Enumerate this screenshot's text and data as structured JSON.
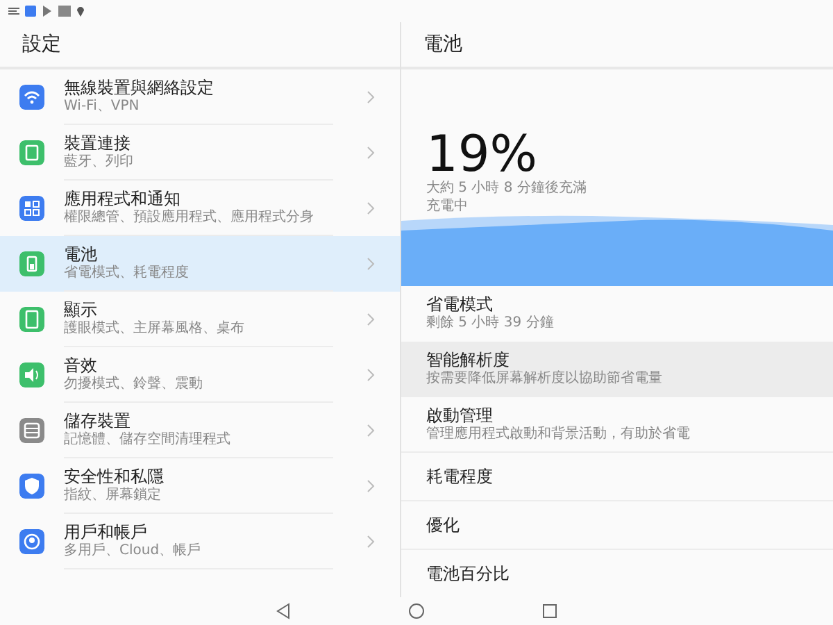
{
  "sidebar": {
    "title": "設定",
    "items": [
      {
        "title": "無線裝置與網絡設定",
        "subtitle": "Wi-Fi、VPN",
        "color": "#3d7cf0",
        "selected": false
      },
      {
        "title": "裝置連接",
        "subtitle": "藍牙、列印",
        "color": "#3dbf6b",
        "selected": false
      },
      {
        "title": "應用程式和通知",
        "subtitle": "權限總管、預設應用程式、應用程式分身",
        "color": "#3d7cf0",
        "selected": false
      },
      {
        "title": "電池",
        "subtitle": "省電模式、耗電程度",
        "color": "#3dbf6b",
        "selected": true
      },
      {
        "title": "顯示",
        "subtitle": "護眼模式、主屏幕風格、桌布",
        "color": "#3dbf6b",
        "selected": false
      },
      {
        "title": "音效",
        "subtitle": "勿擾模式、鈴聲、震動",
        "color": "#3dbf6b",
        "selected": false
      },
      {
        "title": "儲存裝置",
        "subtitle": "記憶體、儲存空間清理程式",
        "color": "#8a8a8a",
        "selected": false
      },
      {
        "title": "安全性和私隱",
        "subtitle": "指紋、屏幕鎖定",
        "color": "#3d7cf0",
        "selected": false
      },
      {
        "title": "用戶和帳戶",
        "subtitle": "多用戶、Cloud、帳戶",
        "color": "#3d7cf0",
        "selected": false
      }
    ]
  },
  "detail": {
    "title": "電池",
    "percent": "19%",
    "estimate": "大約 5 小時 8 分鐘後充滿",
    "status": "充電中",
    "items": [
      {
        "title": "省電模式",
        "subtitle": "剩餘 5 小時 39 分鐘",
        "highlighted": false
      },
      {
        "title": "智能解析度",
        "subtitle": "按需要降低屏幕解析度以協助節省電量",
        "highlighted": true
      },
      {
        "title": "啟動管理",
        "subtitle": "管理應用程式啟動和背景活動，有助於省電",
        "highlighted": false
      },
      {
        "title": "耗電程度",
        "highlighted": false
      },
      {
        "title": "優化",
        "highlighted": false
      },
      {
        "title": "電池百分比",
        "highlighted": false
      }
    ]
  }
}
